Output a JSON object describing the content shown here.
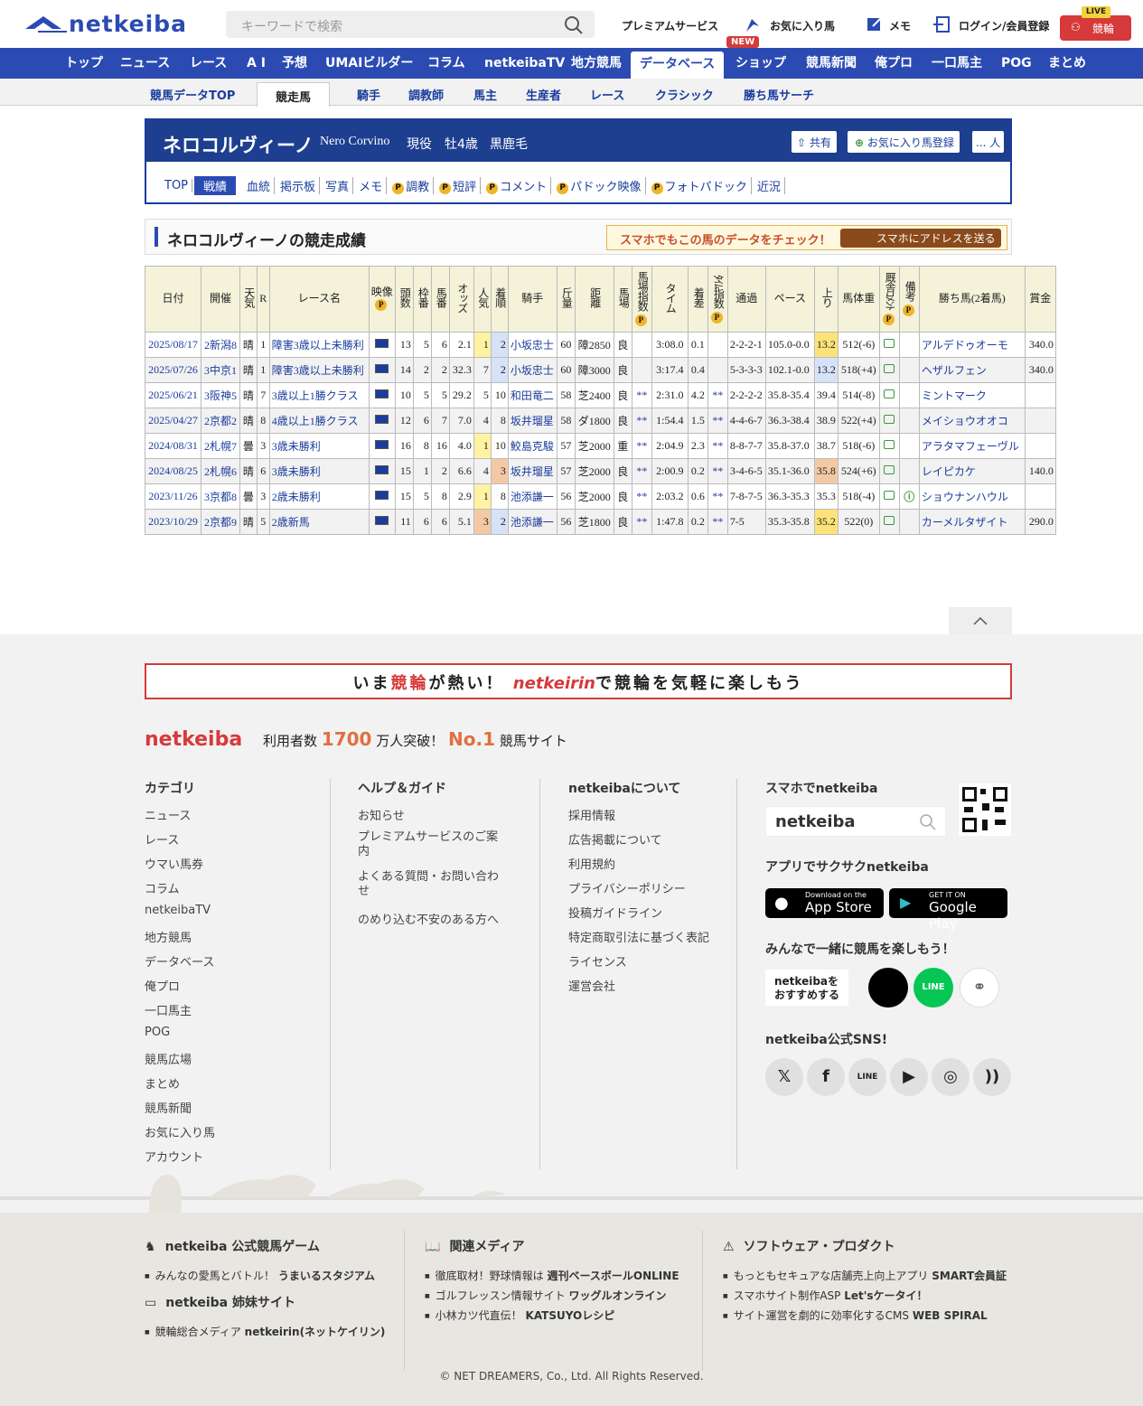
{
  "header": {
    "logo": "netkeiba",
    "search_placeholder": "キーワードで検索",
    "links": [
      "プレミアムサービス",
      "お気に入り馬",
      "メモ",
      "ログイン/会員登録"
    ],
    "keirin": "競輪",
    "live": "LIVE"
  },
  "nav": {
    "items": [
      "トップ",
      "ニュース",
      "レース",
      "A I",
      "予想",
      "UMAIビルダー",
      "コラム",
      "netkeibaTV",
      "地方競馬",
      "データベース",
      "ショップ",
      "競馬新聞",
      "俺プロ",
      "一口馬主",
      "POG",
      "まとめ"
    ],
    "new_badge": "NEW"
  },
  "subnav": {
    "items": [
      "競馬データTOP",
      "競走馬",
      "騎手",
      "調教師",
      "馬主",
      "生産者",
      "レース",
      "クラシック",
      "勝ち馬サーチ"
    ]
  },
  "horse": {
    "name": "ネロコルヴィーノ",
    "name_en": "Nero Corvino",
    "status": "現役",
    "sex_age": "牡4歳",
    "color": "黒鹿毛",
    "share": "共有",
    "fav": "お気に入り馬登録",
    "fav_count": "... 人",
    "tabs": [
      {
        "label": "TOP",
        "p": false
      },
      {
        "label": "戦績",
        "p": false
      },
      {
        "label": "血統",
        "p": false
      },
      {
        "label": "掲示板",
        "p": false
      },
      {
        "label": "写真",
        "p": false
      },
      {
        "label": "メモ",
        "p": false
      },
      {
        "label": "調教",
        "p": true
      },
      {
        "label": "短評",
        "p": true
      },
      {
        "label": "コメント",
        "p": true
      },
      {
        "label": "パドック映像",
        "p": true
      },
      {
        "label": "フォトパドック",
        "p": true
      },
      {
        "label": "近況",
        "p": false
      }
    ]
  },
  "section": {
    "title": "ネロコルヴィーノの競走成績",
    "promo": "スマホでもこの馬のデータをチェック！",
    "promo_btn": "スマホにアドレスを送る"
  },
  "table": {
    "headers": [
      "日付",
      "開催",
      "天気",
      "R",
      "レース名",
      "映像",
      "頭数",
      "枠番",
      "馬番",
      "オッズ",
      "人気",
      "着順",
      "騎手",
      "斤量",
      "距離",
      "馬場",
      "馬場指数",
      "タイム",
      "着差",
      "ﾀｲﾑ指数",
      "通過",
      "ペース",
      "上り",
      "馬体重",
      "厩舎ｺﾒﾝﾄ",
      "備考",
      "勝ち馬(2着馬)",
      "賞金"
    ],
    "rows": [
      [
        "2025/08/17",
        "2新潟8",
        "晴",
        "1",
        "障害3歳以上未勝利",
        "",
        "13",
        "5",
        "6",
        "2.1",
        "1",
        "2",
        "小坂忠士",
        "60",
        "障2850",
        "良",
        "",
        "3:08.0",
        "0.1",
        "",
        "2-2-2-1",
        "105.0-0.0",
        "13.2",
        "512(-6)",
        "",
        "",
        "アルデドゥオーモ",
        "340.0"
      ],
      [
        "2025/07/26",
        "3中京1",
        "晴",
        "1",
        "障害3歳以上未勝利",
        "",
        "14",
        "2",
        "2",
        "32.3",
        "7",
        "2",
        "小坂忠士",
        "60",
        "障3000",
        "良",
        "",
        "3:17.4",
        "0.4",
        "",
        "5-3-3-3",
        "102.1-0.0",
        "13.2",
        "518(+4)",
        "",
        "",
        "ヘザルフェン",
        "340.0"
      ],
      [
        "2025/06/21",
        "3阪神5",
        "晴",
        "7",
        "3歳以上1勝クラス",
        "",
        "10",
        "5",
        "5",
        "29.2",
        "5",
        "10",
        "和田竜二",
        "58",
        "芝2400",
        "良",
        "**",
        "2:31.0",
        "4.2",
        "**",
        "2-2-2-2",
        "35.8-35.4",
        "39.4",
        "514(-8)",
        "",
        "",
        "ミントマーク",
        ""
      ],
      [
        "2025/04/27",
        "2京都2",
        "晴",
        "8",
        "4歳以上1勝クラス",
        "",
        "12",
        "6",
        "7",
        "7.0",
        "4",
        "8",
        "坂井瑠星",
        "58",
        "ダ1800",
        "良",
        "**",
        "1:54.4",
        "1.5",
        "**",
        "4-4-6-7",
        "36.3-38.4",
        "38.9",
        "522(+4)",
        "",
        "",
        "メイショウオオコ",
        ""
      ],
      [
        "2024/08/31",
        "2札幌7",
        "曇",
        "3",
        "3歳未勝利",
        "",
        "16",
        "8",
        "16",
        "4.0",
        "1",
        "10",
        "鮫島克駿",
        "57",
        "芝2000",
        "重",
        "**",
        "2:04.9",
        "2.3",
        "**",
        "8-8-7-7",
        "35.8-37.0",
        "38.7",
        "518(-6)",
        "",
        "",
        "アラタマフェーヴル",
        ""
      ],
      [
        "2024/08/25",
        "2札幌6",
        "晴",
        "6",
        "3歳未勝利",
        "",
        "15",
        "1",
        "2",
        "6.6",
        "4",
        "3",
        "坂井瑠星",
        "57",
        "芝2000",
        "良",
        "**",
        "2:00.9",
        "0.2",
        "**",
        "3-4-6-5",
        "35.1-36.0",
        "35.8",
        "524(+6)",
        "",
        "",
        "レイピカケ",
        "140.0"
      ],
      [
        "2023/11/26",
        "3京都8",
        "曇",
        "3",
        "2歳未勝利",
        "",
        "15",
        "5",
        "8",
        "2.9",
        "1",
        "8",
        "池添謙一",
        "56",
        "芝2000",
        "良",
        "**",
        "2:03.2",
        "0.6",
        "**",
        "7-8-7-5",
        "36.3-35.3",
        "35.3",
        "518(-4)",
        "",
        "",
        "ショウナンハウル",
        ""
      ],
      [
        "2023/10/29",
        "2京都9",
        "晴",
        "5",
        "2歳新馬",
        "",
        "11",
        "6",
        "6",
        "5.1",
        "3",
        "2",
        "池添謙一",
        "56",
        "芝1800",
        "良",
        "**",
        "1:47.8",
        "0.2",
        "**",
        "7-5",
        "35.3-35.8",
        "35.2",
        "522(0)",
        "",
        "",
        "カーメルタザイト",
        "290.0"
      ]
    ]
  },
  "footer": {
    "banner_pre": "いま",
    "banner_keirin": "競輪",
    "banner_mid": "が熱い！",
    "banner_brand": "netkeirin",
    "banner_post": "で競輪を気軽に楽しもう",
    "logo": "netkeiba",
    "users_pre": "利用者数",
    "users_num": "1700",
    "users_mid": "万人突破！",
    "users_no": "No.1",
    "users_post": "競馬サイト",
    "cat_title": "カテゴリ",
    "cats": [
      "ニュース",
      "レース",
      "ウマい馬券",
      "コラム",
      "netkeibaTV",
      "地方競馬",
      "データベース",
      "俺プロ",
      "一口馬主",
      "POG",
      "競馬広場",
      "まとめ",
      "競馬新聞",
      "お気に入り馬",
      "アカウント"
    ],
    "help_title": "ヘルプ＆ガイド",
    "help": [
      "お知らせ",
      "プレミアムサービスのご案内",
      "よくある質問・お問い合わせ",
      "のめり込む不安のある方へ"
    ],
    "about_title": "netkeibaについて",
    "about": [
      "採用情報",
      "広告掲載について",
      "利用規約",
      "プライバシーポリシー",
      "投稿ガイドライン",
      "特定商取引法に基づく表記",
      "ライセンス",
      "運営会社"
    ],
    "sp_title": "スマホでnetkeiba",
    "sp_search": "netkeiba",
    "app_title": "アプリでサクサクnetkeiba",
    "appstore": "App Store",
    "appstore_small": "Download on the",
    "googleplay": "Google Play",
    "googleplay_small": "GET IT ON",
    "share_title": "みんなで一緒に競馬を楽しもう！",
    "share_btn": "netkeibaをおすすめする",
    "sns_title": "netkeiba公式SNS!",
    "game_title": "netkeiba 公式競馬ゲーム",
    "game": [
      {
        "pre": "みんなの愛馬とバトル！",
        "b": "うまいるスタジアム"
      }
    ],
    "sister_title": "netkeiba 姉妹サイト",
    "sister": [
      {
        "pre": "競輪総合メディア",
        "b": "netkeirin(ネットケイリン)"
      }
    ],
    "media_title": "関連メディア",
    "media": [
      {
        "pre": "徹底取材！野球情報は",
        "b": "週刊ベースボールONLINE"
      },
      {
        "pre": "ゴルフレッスン情報サイト",
        "b": "ワッグルオンライン"
      },
      {
        "pre": "小林カツ代直伝！",
        "b": "KATSUYOレシピ"
      }
    ],
    "soft_title": "ソフトウェア・プロダクト",
    "soft": [
      {
        "pre": "もっともセキュアな店舗売上向上アプリ",
        "b": "SMART会員証"
      },
      {
        "pre": "スマホサイト制作ASP",
        "b": "Let'sケータイ！"
      },
      {
        "pre": "サイト運営を劇的に効率化するCMS",
        "b": "WEB SPIRAL"
      }
    ],
    "copyright": "© NET DREAMERS, Co., Ltd. All Rights Reserved."
  },
  "colors": {
    "brand": "#2b4bb3",
    "accent": "#d63a3a"
  }
}
